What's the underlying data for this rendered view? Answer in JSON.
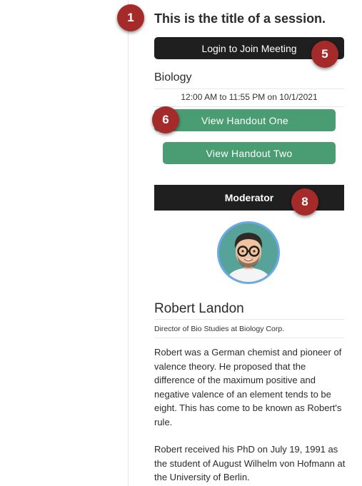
{
  "session": {
    "title": "This is the title of a session.",
    "login_label": "Login to Join Meeting",
    "category": "Biology",
    "time": "12:00 AM to 11:55 PM on 10/1/2021",
    "handouts": [
      "View Handout One",
      "View Handout Two"
    ]
  },
  "moderator": {
    "header": "Moderator",
    "name": "Robert Landon",
    "role": "Director of Bio Studies at Biology Corp.",
    "bio": [
      "Robert was a German chemist and pioneer of valence theory. He proposed that the difference of the maximum positive and negative valence of an element tends to be eight. This has come to be known as Robert's rule.",
      "Robert received his PhD on July 19, 1991 as the student of August Wilhelm von Hofmann at the University of Berlin."
    ]
  },
  "badges": [
    "1",
    "5",
    "6",
    "8"
  ],
  "colors": {
    "dark_button": "#1f1f1f",
    "handout_button": "#4a9d73",
    "badge": "#a52b2b",
    "avatar_ring": "#6aa8e8"
  }
}
